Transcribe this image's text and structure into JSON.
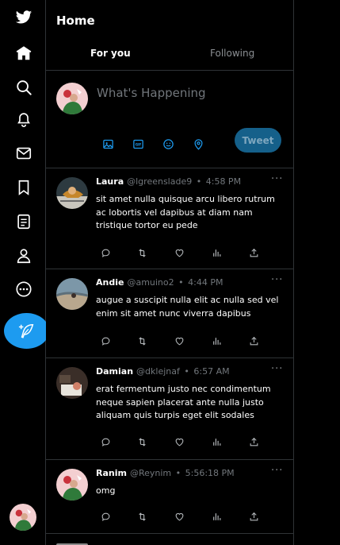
{
  "page": {
    "title": "Home"
  },
  "tabs": [
    {
      "label": "For you",
      "active": true
    },
    {
      "label": "Following",
      "active": false
    }
  ],
  "nav": {
    "items": [
      {
        "name": "twitter-logo",
        "icon": "bird-icon"
      },
      {
        "name": "home",
        "icon": "home-icon"
      },
      {
        "name": "explore",
        "icon": "search-icon"
      },
      {
        "name": "notifications",
        "icon": "bell-icon"
      },
      {
        "name": "messages",
        "icon": "mail-icon"
      },
      {
        "name": "bookmarks",
        "icon": "bookmark-icon"
      },
      {
        "name": "lists",
        "icon": "list-icon"
      },
      {
        "name": "profile",
        "icon": "person-icon"
      },
      {
        "name": "more",
        "icon": "more-circle-icon"
      }
    ],
    "compose_icon": "feather-plus-icon"
  },
  "composer": {
    "placeholder": "What's Happening",
    "tweet_label": "Tweet",
    "icons": [
      "image-icon",
      "gif-icon",
      "emoji-icon",
      "location-icon"
    ]
  },
  "tweets": [
    {
      "name": "Laura",
      "handle": "@lgreenslade9",
      "dot": "•",
      "time": "4:58 PM",
      "more": "···",
      "text": "sit amet nulla quisque arcu libero rutrum ac lobortis vel dapibus at diam nam tristique tortor eu pede"
    },
    {
      "name": "Andie",
      "handle": "@amuino2",
      "dot": "•",
      "time": "4:44 PM",
      "more": "···",
      "text": "augue a suscipit nulla elit ac nulla sed vel enim sit amet nunc viverra dapibus"
    },
    {
      "name": "Damian",
      "handle": "@dklejnaf",
      "dot": "•",
      "time": "6:57 AM",
      "more": "···",
      "text": "erat fermentum justo nec condimentum neque sapien placerat ante nulla justo aliquam quis turpis eget elit sodales"
    },
    {
      "name": "Ranim",
      "handle": "@Reynim",
      "dot": "•",
      "time": "5:56:18 PM",
      "more": "···",
      "text": "omg"
    }
  ],
  "tweet_actions": [
    "reply-icon",
    "retweet-icon",
    "like-icon",
    "views-icon",
    "share-icon"
  ],
  "colors": {
    "accent": "#1d9bf0",
    "background": "#000000",
    "border": "#2f3336",
    "muted": "#71767b"
  }
}
